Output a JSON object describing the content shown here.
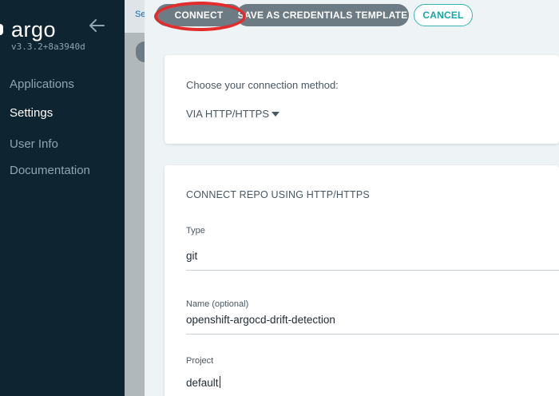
{
  "sidebar": {
    "brand": "argo",
    "version": "v3.3.2+8a3940d",
    "items": [
      {
        "label": "Applications",
        "active": false
      },
      {
        "label": "Settings",
        "active": true
      },
      {
        "label": "User Info",
        "active": false
      },
      {
        "label": "Documentation",
        "active": false
      }
    ]
  },
  "background": {
    "breadcrumb": "Se"
  },
  "toolbar": {
    "connect_label": "CONNECT",
    "template_label": "SAVE AS CREDENTIALS TEMPLATE",
    "cancel_label": "CANCEL"
  },
  "method_card": {
    "label": "Choose your connection method:",
    "selected": "VIA HTTP/HTTPS"
  },
  "repo_card": {
    "title": "CONNECT REPO USING HTTP/HTTPS",
    "fields": [
      {
        "label": "Type",
        "value": "git"
      },
      {
        "label": "Name (optional)",
        "value": "openshift-argocd-drift-detection"
      },
      {
        "label": "Project",
        "value": "default"
      }
    ]
  },
  "colors": {
    "sidebar_bg": "#0e2431",
    "button_gray": "#6d7b84",
    "accent_teal": "#1aa5a5",
    "annotation_red": "#e32d2d"
  }
}
